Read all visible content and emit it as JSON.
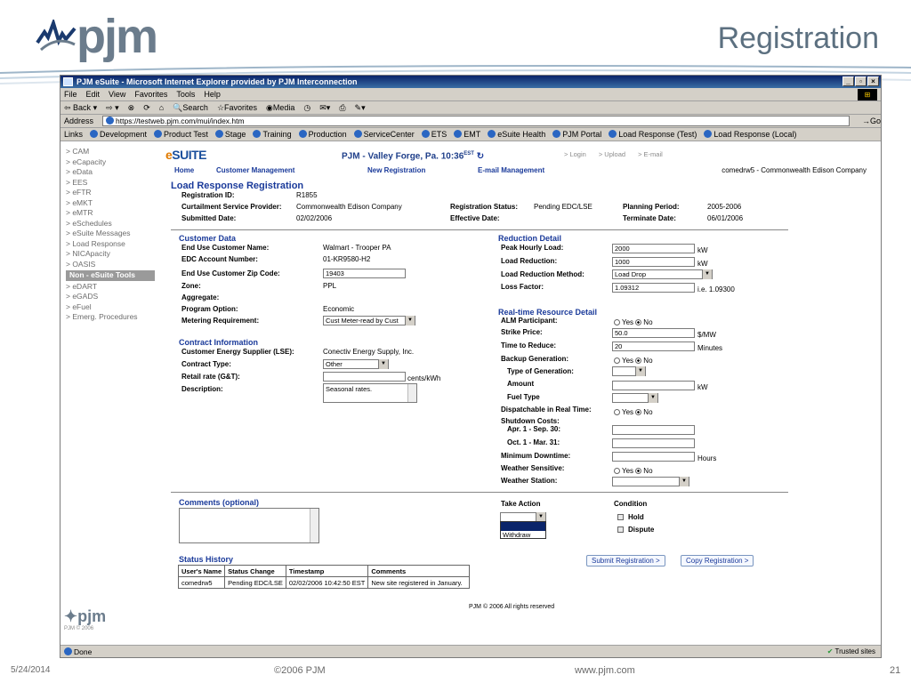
{
  "slide": {
    "logo_text": "pjm",
    "title": "Registration",
    "date": "5/24/2014",
    "copyright": "©2006 PJM",
    "url": "www.pjm.com",
    "page_number": "21"
  },
  "browser": {
    "title": "PJM eSuite - Microsoft Internet Explorer provided by PJM Interconnection",
    "menu": [
      "File",
      "Edit",
      "View",
      "Favorites",
      "Tools",
      "Help"
    ],
    "toolbar": [
      "Back",
      "Search",
      "Favorites",
      "Media"
    ],
    "address_label": "Address",
    "address": "https://testweb.pjm.com/mui/index.htm",
    "go_label": "Go",
    "links_label": "Links",
    "links": [
      "Development",
      "Product Test",
      "Stage",
      "Training",
      "Production",
      "ServiceCenter",
      "ETS",
      "EMT",
      "eSuite Health",
      "PJM Portal",
      "Load Response (Test)",
      "Load Response (Local)"
    ],
    "status": "Done",
    "zone": "Trusted sites"
  },
  "nav": {
    "items": [
      "> CAM",
      "> eCapacity",
      "> eData",
      "> EES",
      "> eFTR",
      "> eMKT",
      "> eMTR",
      "> eSchedules",
      "> eSuite Messages",
      "> Load Response",
      "> NICApacity",
      "> OASIS",
      "Non - eSuite Tools",
      "> eDART",
      "> eGADS",
      "> eFuel",
      "> Emerg. Procedures"
    ]
  },
  "header": {
    "brand_e": "e",
    "brand_suite": "SUITE",
    "location": "PJM - Valley Forge, Pa. 10:36",
    "tz": "EST",
    "top_links": [
      "> Login",
      "> Upload",
      "> E-mail"
    ],
    "nav_links": [
      "Home",
      "Customer Management",
      "New Registration",
      "E-mail Management"
    ],
    "user": "comedrw5 - Commonwealth Edison Company"
  },
  "registration": {
    "heading": "Load Response Registration",
    "reg_id_label": "Registration ID:",
    "reg_id": "R1855",
    "csp_label": "Curtailment Service Provider:",
    "csp": "Commonwealth Edison Company",
    "submitted_label": "Submitted Date:",
    "submitted": "02/02/2006",
    "status_label": "Registration Status:",
    "status": "Pending EDC/LSE",
    "effective_label": "Effective Date:",
    "period_label": "Planning Period:",
    "period": "2005-2006",
    "terminate_label": "Terminate Date:",
    "terminate": "06/01/2006"
  },
  "customer": {
    "heading": "Customer Data",
    "name_label": "End Use Customer Name:",
    "name": "Walmart - Trooper PA",
    "edc_label": "EDC Account Number:",
    "edc": "01-KR9580-H2",
    "zip_label": "End Use Customer Zip Code:",
    "zip": "19403",
    "zone_label": "Zone:",
    "zone": "PPL",
    "aggregate_label": "Aggregate:",
    "program_label": "Program Option:",
    "program": "Economic",
    "metering_label": "Metering Requirement:",
    "metering": "Cust Meter-read by Cust"
  },
  "contract": {
    "heading": "Contract Information",
    "lse_label": "Customer Energy Supplier (LSE):",
    "lse": "Conectiv Energy Supply, Inc.",
    "type_label": "Contract Type:",
    "type": "Other",
    "rate_label": "Retail rate (G&T):",
    "rate_unit": "cents/kWh",
    "desc_label": "Description:",
    "desc": "Seasonal rates."
  },
  "reduction": {
    "heading": "Reduction Detail",
    "peak_label": "Peak Hourly Load:",
    "peak": "2000",
    "peak_unit": "kW",
    "red_label": "Load Reduction:",
    "red": "1000",
    "red_unit": "kW",
    "method_label": "Load Reduction Method:",
    "method": "Load Drop",
    "loss_label": "Loss Factor:",
    "loss": "1.09312",
    "loss_hint": "i.e. 1.09300"
  },
  "realtime": {
    "heading": "Real-time Resource Detail",
    "alm_label": "ALM Participant:",
    "yes": "Yes",
    "no": "No",
    "strike_label": "Strike Price:",
    "strike": "50.0",
    "strike_unit": "$/MW",
    "reduce_label": "Time to Reduce:",
    "reduce": "20",
    "reduce_unit": "Minutes",
    "backup_label": "Backup Generation:",
    "gentype_label": "Type of Generation:",
    "amount_label": "Amount",
    "amount_unit": "kW",
    "fuel_label": "Fuel Type",
    "dispatch_label": "Dispatchable in Real Time:",
    "shutdown_label": "Shutdown Costs:",
    "apr_label": "Apr. 1 - Sep. 30:",
    "oct_label": "Oct. 1 - Mar. 31:",
    "mindown_label": "Minimum Downtime:",
    "mindown_unit": "Hours",
    "weather_label": "Weather Sensitive:",
    "station_label": "Weather Station:"
  },
  "comments": {
    "heading": "Comments (optional)",
    "take_action": "Take Action",
    "withdraw": "Withdraw",
    "condition": "Condition",
    "hold": "Hold",
    "dispute": "Dispute"
  },
  "history": {
    "heading": "Status History",
    "columns": [
      "User's Name",
      "Status Change",
      "Timestamp",
      "Comments"
    ],
    "rows": [
      [
        "comedrw5",
        "Pending EDC/LSE",
        "02/02/2006 10:42:50 EST",
        "New site registered in January."
      ]
    ]
  },
  "buttons": {
    "submit": "Submit Registration >",
    "copy": "Copy Registration >"
  },
  "page_footer": "PJM © 2006 All rights reserved",
  "small_logo": "pjm",
  "small_logo_copy": "PJM © 2006"
}
